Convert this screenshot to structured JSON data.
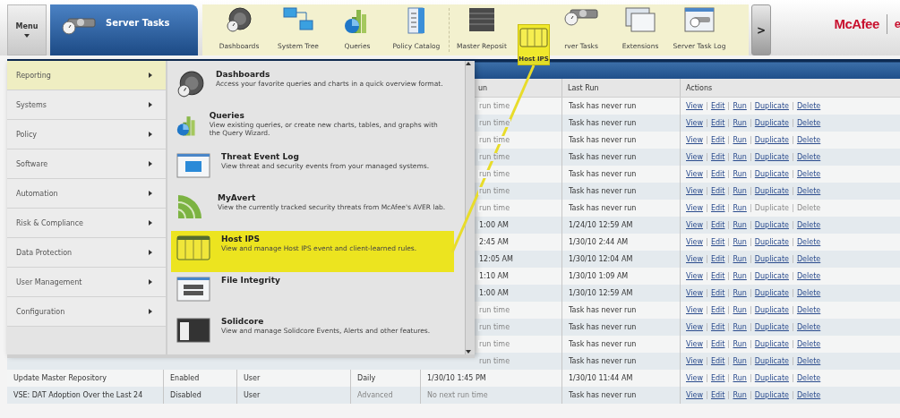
{
  "menu_button": {
    "label": "Menu"
  },
  "active_tab": {
    "label": "Server Tasks"
  },
  "toolbar_groups": [
    [
      {
        "label": "Dashboards"
      },
      {
        "label": "System Tree"
      },
      {
        "label": "Queries"
      },
      {
        "label": "Policy Catalog"
      }
    ],
    [
      {
        "label": "Master Reposit"
      },
      {
        "label": "rver Tasks"
      },
      {
        "label": "Extensions"
      },
      {
        "label": "Server Task Log"
      }
    ]
  ],
  "toolbar_scroll": {
    "label": ">"
  },
  "brand": {
    "logo": "McAfee",
    "product": "e"
  },
  "callout": {
    "label": "Host IPS"
  },
  "menu": {
    "categories": [
      {
        "label": "Reporting",
        "selected": true
      },
      {
        "label": "Systems",
        "selected": false
      },
      {
        "label": "Policy",
        "selected": false
      },
      {
        "label": "Software",
        "selected": false
      },
      {
        "label": "Automation",
        "selected": false
      },
      {
        "label": "Risk & Compliance",
        "selected": false
      },
      {
        "label": "Data Protection",
        "selected": false
      },
      {
        "label": "User Management",
        "selected": false
      },
      {
        "label": "Configuration",
        "selected": false
      }
    ],
    "entries": [
      {
        "title": "Dashboards",
        "description": "Access your favorite queries and charts in a quick overview format.",
        "highlighted": false
      },
      {
        "title": "Queries",
        "description": "View existing queries, or create new charts, tables, and graphs with the Query Wizard.",
        "highlighted": false
      },
      {
        "title": "Threat Event Log",
        "description": "View threat and security events from your managed systems.",
        "highlighted": false
      },
      {
        "title": "MyAvert",
        "description": "View the currently tracked security threats from McAfee's AVER lab.",
        "highlighted": false
      },
      {
        "title": "Host IPS",
        "description": "View and manage Host IPS event and client-learned rules.",
        "highlighted": true
      },
      {
        "title": "File Integrity",
        "highlighted": false
      },
      {
        "title": "Solidcore",
        "description": "View and manage Solidcore Events, Alerts and other features.",
        "highlighted": false
      }
    ]
  },
  "table": {
    "columns": [
      "un",
      "Last Run",
      "Actions"
    ],
    "rows": [
      {
        "next_run": "run time",
        "next_run_muted": true,
        "last_run": "Task has never run",
        "actions": [
          {
            "label": "View",
            "disabled": false
          },
          {
            "label": "Edit",
            "disabled": false
          },
          {
            "label": "Run",
            "disabled": false
          },
          {
            "label": "Duplicate",
            "disabled": false
          },
          {
            "label": "Delete",
            "disabled": false
          }
        ]
      },
      {
        "next_run": "run time",
        "next_run_muted": true,
        "last_run": "Task has never run",
        "actions": [
          {
            "label": "View",
            "disabled": false
          },
          {
            "label": "Edit",
            "disabled": false
          },
          {
            "label": "Run",
            "disabled": false
          },
          {
            "label": "Duplicate",
            "disabled": false
          },
          {
            "label": "Delete",
            "disabled": false
          }
        ]
      },
      {
        "next_run": "run time",
        "next_run_muted": true,
        "last_run": "Task has never run",
        "actions": [
          {
            "label": "View",
            "disabled": false
          },
          {
            "label": "Edit",
            "disabled": false
          },
          {
            "label": "Run",
            "disabled": false
          },
          {
            "label": "Duplicate",
            "disabled": false
          },
          {
            "label": "Delete",
            "disabled": false
          }
        ]
      },
      {
        "next_run": "run time",
        "next_run_muted": true,
        "last_run": "Task has never run",
        "actions": [
          {
            "label": "View",
            "disabled": false
          },
          {
            "label": "Edit",
            "disabled": false
          },
          {
            "label": "Run",
            "disabled": false
          },
          {
            "label": "Duplicate",
            "disabled": false
          },
          {
            "label": "Delete",
            "disabled": false
          }
        ]
      },
      {
        "next_run": "run time",
        "next_run_muted": true,
        "last_run": "Task has never run",
        "actions": [
          {
            "label": "View",
            "disabled": false
          },
          {
            "label": "Edit",
            "disabled": false
          },
          {
            "label": "Run",
            "disabled": false
          },
          {
            "label": "Duplicate",
            "disabled": false
          },
          {
            "label": "Delete",
            "disabled": false
          }
        ]
      },
      {
        "next_run": "run time",
        "next_run_muted": true,
        "last_run": "Task has never run",
        "actions": [
          {
            "label": "View",
            "disabled": false
          },
          {
            "label": "Edit",
            "disabled": false
          },
          {
            "label": "Run",
            "disabled": false
          },
          {
            "label": "Duplicate",
            "disabled": false
          },
          {
            "label": "Delete",
            "disabled": false
          }
        ]
      },
      {
        "next_run": "run time",
        "next_run_muted": true,
        "last_run": "Task has never run",
        "actions": [
          {
            "label": "View",
            "disabled": false
          },
          {
            "label": "Edit",
            "disabled": false
          },
          {
            "label": "Run",
            "disabled": false
          },
          {
            "label": "Duplicate",
            "disabled": true
          },
          {
            "label": "Delete",
            "disabled": true
          }
        ]
      },
      {
        "next_run": "1:00 AM",
        "next_run_muted": false,
        "last_run": "1/24/10 12:59 AM",
        "actions": [
          {
            "label": "View",
            "disabled": false
          },
          {
            "label": "Edit",
            "disabled": false
          },
          {
            "label": "Run",
            "disabled": false
          },
          {
            "label": "Duplicate",
            "disabled": false
          },
          {
            "label": "Delete",
            "disabled": false
          }
        ]
      },
      {
        "next_run": "2:45 AM",
        "next_run_muted": false,
        "last_run": "1/30/10 2:44 AM",
        "actions": [
          {
            "label": "View",
            "disabled": false
          },
          {
            "label": "Edit",
            "disabled": false
          },
          {
            "label": "Run",
            "disabled": false
          },
          {
            "label": "Duplicate",
            "disabled": false
          },
          {
            "label": "Delete",
            "disabled": false
          }
        ]
      },
      {
        "next_run": "12:05 AM",
        "next_run_muted": false,
        "last_run": "1/30/10 12:04 AM",
        "actions": [
          {
            "label": "View",
            "disabled": false
          },
          {
            "label": "Edit",
            "disabled": false
          },
          {
            "label": "Run",
            "disabled": false
          },
          {
            "label": "Duplicate",
            "disabled": false
          },
          {
            "label": "Delete",
            "disabled": false
          }
        ]
      },
      {
        "next_run": "1:10 AM",
        "next_run_muted": false,
        "last_run": "1/30/10 1:09 AM",
        "actions": [
          {
            "label": "View",
            "disabled": false
          },
          {
            "label": "Edit",
            "disabled": false
          },
          {
            "label": "Run",
            "disabled": false
          },
          {
            "label": "Duplicate",
            "disabled": false
          },
          {
            "label": "Delete",
            "disabled": false
          }
        ]
      },
      {
        "next_run": "1:00 AM",
        "next_run_muted": false,
        "last_run": "1/30/10 12:59 AM",
        "actions": [
          {
            "label": "View",
            "disabled": false
          },
          {
            "label": "Edit",
            "disabled": false
          },
          {
            "label": "Run",
            "disabled": false
          },
          {
            "label": "Duplicate",
            "disabled": false
          },
          {
            "label": "Delete",
            "disabled": false
          }
        ]
      },
      {
        "next_run": "run time",
        "next_run_muted": true,
        "last_run": "Task has never run",
        "actions": [
          {
            "label": "View",
            "disabled": false
          },
          {
            "label": "Edit",
            "disabled": false
          },
          {
            "label": "Run",
            "disabled": false
          },
          {
            "label": "Duplicate",
            "disabled": false
          },
          {
            "label": "Delete",
            "disabled": false
          }
        ]
      },
      {
        "next_run": "run time",
        "next_run_muted": true,
        "last_run": "Task has never run",
        "actions": [
          {
            "label": "View",
            "disabled": false
          },
          {
            "label": "Edit",
            "disabled": false
          },
          {
            "label": "Run",
            "disabled": false
          },
          {
            "label": "Duplicate",
            "disabled": false
          },
          {
            "label": "Delete",
            "disabled": false
          }
        ]
      },
      {
        "next_run": "run time",
        "next_run_muted": true,
        "last_run": "Task has never run",
        "actions": [
          {
            "label": "View",
            "disabled": false
          },
          {
            "label": "Edit",
            "disabled": false
          },
          {
            "label": "Run",
            "disabled": false
          },
          {
            "label": "Duplicate",
            "disabled": false
          },
          {
            "label": "Delete",
            "disabled": false
          }
        ]
      },
      {
        "next_run": "run time",
        "next_run_muted": true,
        "last_run": "Task has never run",
        "actions": [
          {
            "label": "View",
            "disabled": false
          },
          {
            "label": "Edit",
            "disabled": false
          },
          {
            "label": "Run",
            "disabled": false
          },
          {
            "label": "Duplicate",
            "disabled": false
          },
          {
            "label": "Delete",
            "disabled": false
          }
        ]
      },
      {
        "name": "Update Master Repository",
        "status": "Enabled",
        "owner": "User",
        "schedule": "Daily",
        "schedule_muted": false,
        "next_run": "1/30/10 1:45 PM",
        "next_run_muted": false,
        "last_run": "1/30/10 11:44 AM",
        "actions": [
          {
            "label": "View",
            "disabled": false
          },
          {
            "label": "Edit",
            "disabled": false
          },
          {
            "label": "Run",
            "disabled": false
          },
          {
            "label": "Duplicate",
            "disabled": false
          },
          {
            "label": "Delete",
            "disabled": false
          }
        ]
      },
      {
        "name": "VSE: DAT Adoption Over the Last 24",
        "status": "Disabled",
        "owner": "User",
        "schedule": "Advanced",
        "schedule_muted": true,
        "next_run": "No next run time",
        "next_run_muted": true,
        "last_run": "Task has never run",
        "actions": [
          {
            "label": "View",
            "disabled": false
          },
          {
            "label": "Edit",
            "disabled": false
          },
          {
            "label": "Run",
            "disabled": false
          },
          {
            "label": "Duplicate",
            "disabled": false
          },
          {
            "label": "Delete",
            "disabled": false
          }
        ]
      }
    ]
  }
}
